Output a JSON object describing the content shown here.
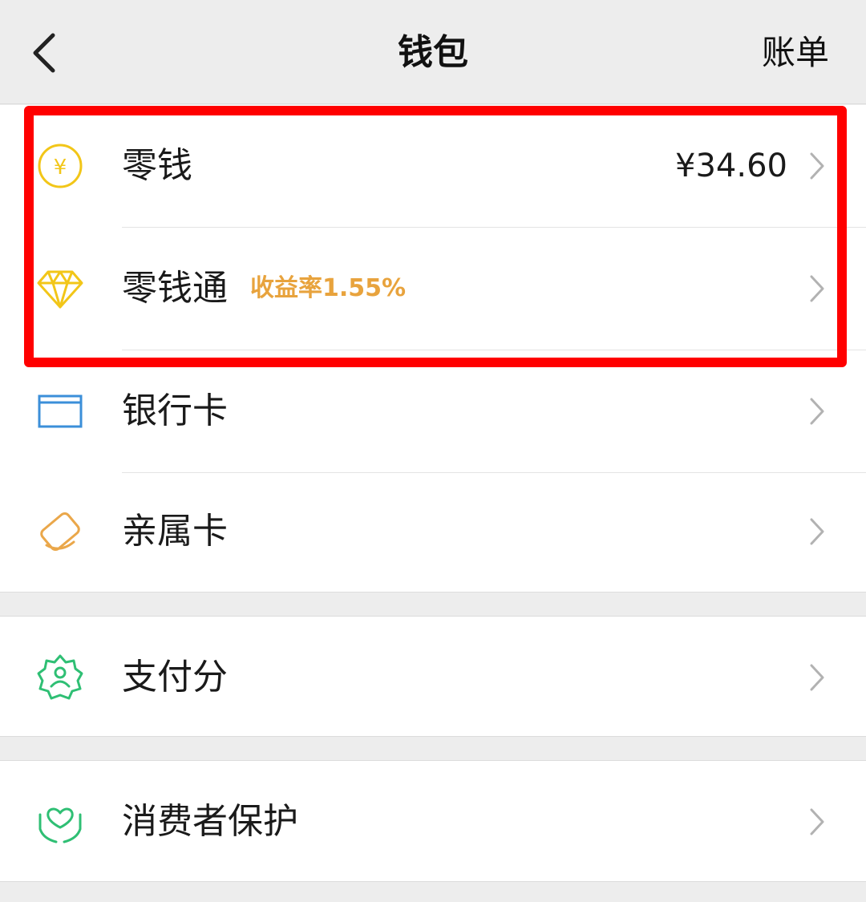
{
  "header": {
    "back_icon": "chevron-left-icon",
    "title": "钱包",
    "action": "账单"
  },
  "items": [
    {
      "label": "零钱",
      "icon": "yuan-coin-icon",
      "value": "¥34.60",
      "color": "#f2c618"
    },
    {
      "label": "零钱通",
      "icon": "diamond-icon",
      "badge": "收益率1.55%",
      "color": "#f2c618",
      "badge_color": "#e8a33d"
    },
    {
      "label": "银行卡",
      "icon": "bank-card-icon",
      "color": "#3b8fd9"
    },
    {
      "label": "亲属卡",
      "icon": "family-card-icon",
      "color": "#eaa74a"
    },
    {
      "label": "支付分",
      "icon": "pay-score-icon",
      "color": "#2fbf74"
    },
    {
      "label": "消费者保护",
      "icon": "consumer-protection-icon",
      "color": "#2fbf74"
    }
  ],
  "colors": {
    "background": "#ededed",
    "highlight": "#ff0000",
    "chevron": "#b2b2b2"
  }
}
